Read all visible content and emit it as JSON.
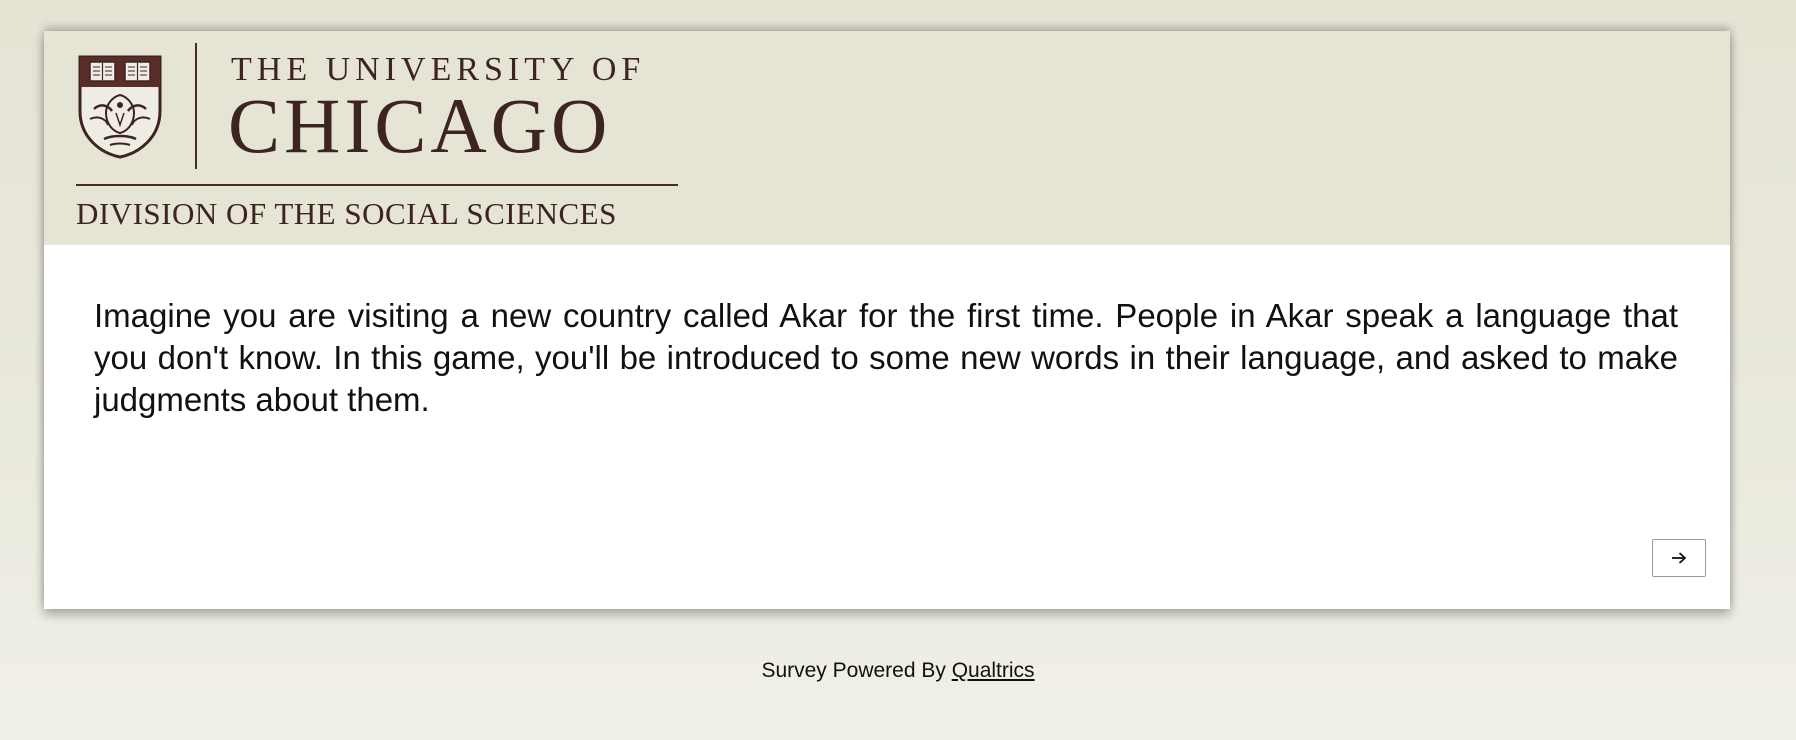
{
  "header": {
    "logo": {
      "line1": "THE UNIVERSITY OF",
      "line2": "CHICAGO",
      "line3": "DIVISION OF THE SOCIAL SCIENCES",
      "crest_icon": "university-crest-icon",
      "color": "#3e2421"
    }
  },
  "question": {
    "text": "Imagine you are visiting a new country called Akar for the first time. People in Akar speak a language that you don't know. In this game, you'll be introduced to some new words in their language, and asked to make judgments about them."
  },
  "navigation": {
    "next_icon": "arrow-right-icon"
  },
  "footer": {
    "prefix": "Survey Powered By ",
    "link_text": "Qualtrics"
  },
  "colors": {
    "header_bg": "#e5e4d5",
    "panel_bg": "#ffffff",
    "logo_brown": "#3e2421"
  }
}
